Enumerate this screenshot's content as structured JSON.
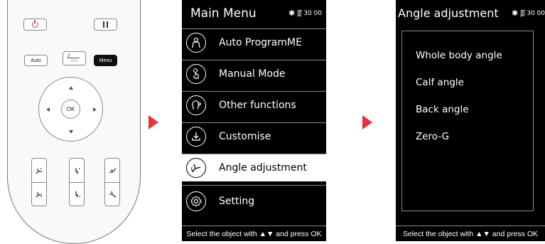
{
  "remote": {
    "auto_label": "Auto",
    "zero_label": "Zero",
    "menu_label": "Menu",
    "ok_label": "OK"
  },
  "colors": {
    "arrow": "#e8323c",
    "screen_bg": "#000000",
    "selected_bg": "#ffffff"
  },
  "main_menu": {
    "title": "Main Menu",
    "status": "30 00",
    "items": [
      {
        "label": "Auto ProgramME",
        "icon": "person-outline-icon"
      },
      {
        "label": "Manual Mode",
        "icon": "hand-touch-icon"
      },
      {
        "label": "Other functions",
        "icon": "head-profile-icon"
      },
      {
        "label": "Customise",
        "icon": "download-icon"
      },
      {
        "label": "Angle adjustment",
        "icon": "recline-chair-icon",
        "selected": true
      },
      {
        "label": "Setting",
        "icon": "gear-icon"
      }
    ],
    "footer": "Select the object with ▲▼ and press OK"
  },
  "angle_menu": {
    "title": "Angle adjustment",
    "status": "30 00",
    "items": [
      "Whole body angle",
      "Calf angle",
      "Back angle",
      "Zero-G"
    ],
    "footer": "Select the object with ▲▼ and press OK"
  }
}
